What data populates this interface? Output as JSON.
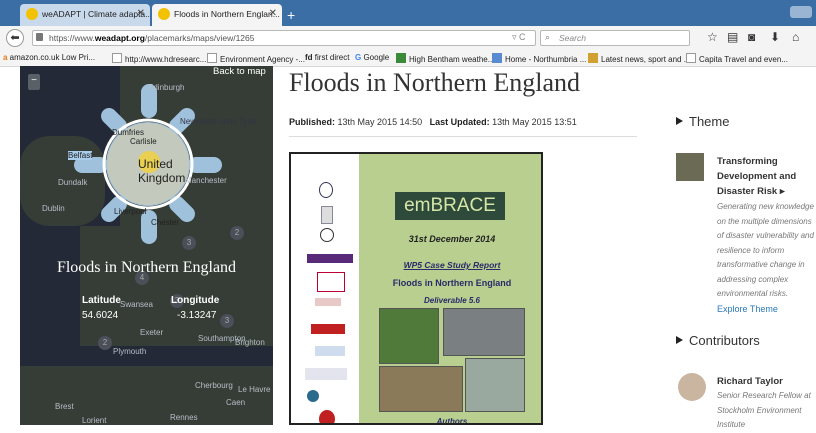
{
  "browser": {
    "tabs": [
      {
        "label": "weADAPT | Climate adapta...",
        "active": false
      },
      {
        "label": "Floods in Northern Englan...",
        "active": true
      }
    ],
    "url_prefix": "https://www.",
    "url_domain": "weadapt.org",
    "url_path": "/placemarks/maps/view/1265",
    "search_placeholder": "Search",
    "bookmarks": [
      "amazon.co.uk Low Pri...",
      "http://www.hdresearc...",
      "Environment Agency -...",
      "first direct",
      "Google",
      "High Bentham weathe...",
      "Home - Northumbria ...",
      "Latest news, sport and ...",
      "Capita Travel and even..."
    ]
  },
  "map": {
    "back_label": "Back to map",
    "zoom_label": "−",
    "title": "Floods in Northern England",
    "latitude_label": "Latitude",
    "latitude_value": "54.6024",
    "longitude_label": "Longitude",
    "longitude_value": "-3.13247",
    "place_labels": [
      "Edinburgh",
      "Newcastle upon Tyne",
      "Dumfries",
      "Carlisle",
      "Belfast",
      "United Kingdom",
      "Liverpool",
      "Chester",
      "Manchester",
      "Dublin",
      "Dundalk",
      "Swansea",
      "Plymouth",
      "Cherbourg",
      "Le Havre",
      "Caen",
      "Rennes",
      "Brest",
      "Lorient",
      "Exeter",
      "Southampton",
      "Brighton"
    ]
  },
  "article": {
    "title": "Floods in Northern England",
    "published_label": "Published:",
    "published_value": "13th May 2015 14:50",
    "updated_label": "Last Updated:",
    "updated_value": "13th May 2015 13:51",
    "cover": {
      "brand": "emBRACE",
      "date": "31st December 2014",
      "report": "WP5 Case Study Report",
      "subtitle": "Floods in Northern England",
      "deliverable": "Deliverable 5.6",
      "authors": "Authors"
    }
  },
  "sidebar": {
    "theme_heading": "Theme",
    "theme_title": "Transforming Development and Disaster Risk ▸",
    "theme_description": "Generating new knowledge on the multiple dimensions of disaster vulnerability and resilience to inform transformative change in addressing complex environmental risks.",
    "explore_link": "Explore Theme",
    "contributors_heading": "Contributors",
    "contributor_name": "Richard Taylor",
    "contributor_role": "Senior Research Fellow at Stockholm Environment Institute"
  }
}
